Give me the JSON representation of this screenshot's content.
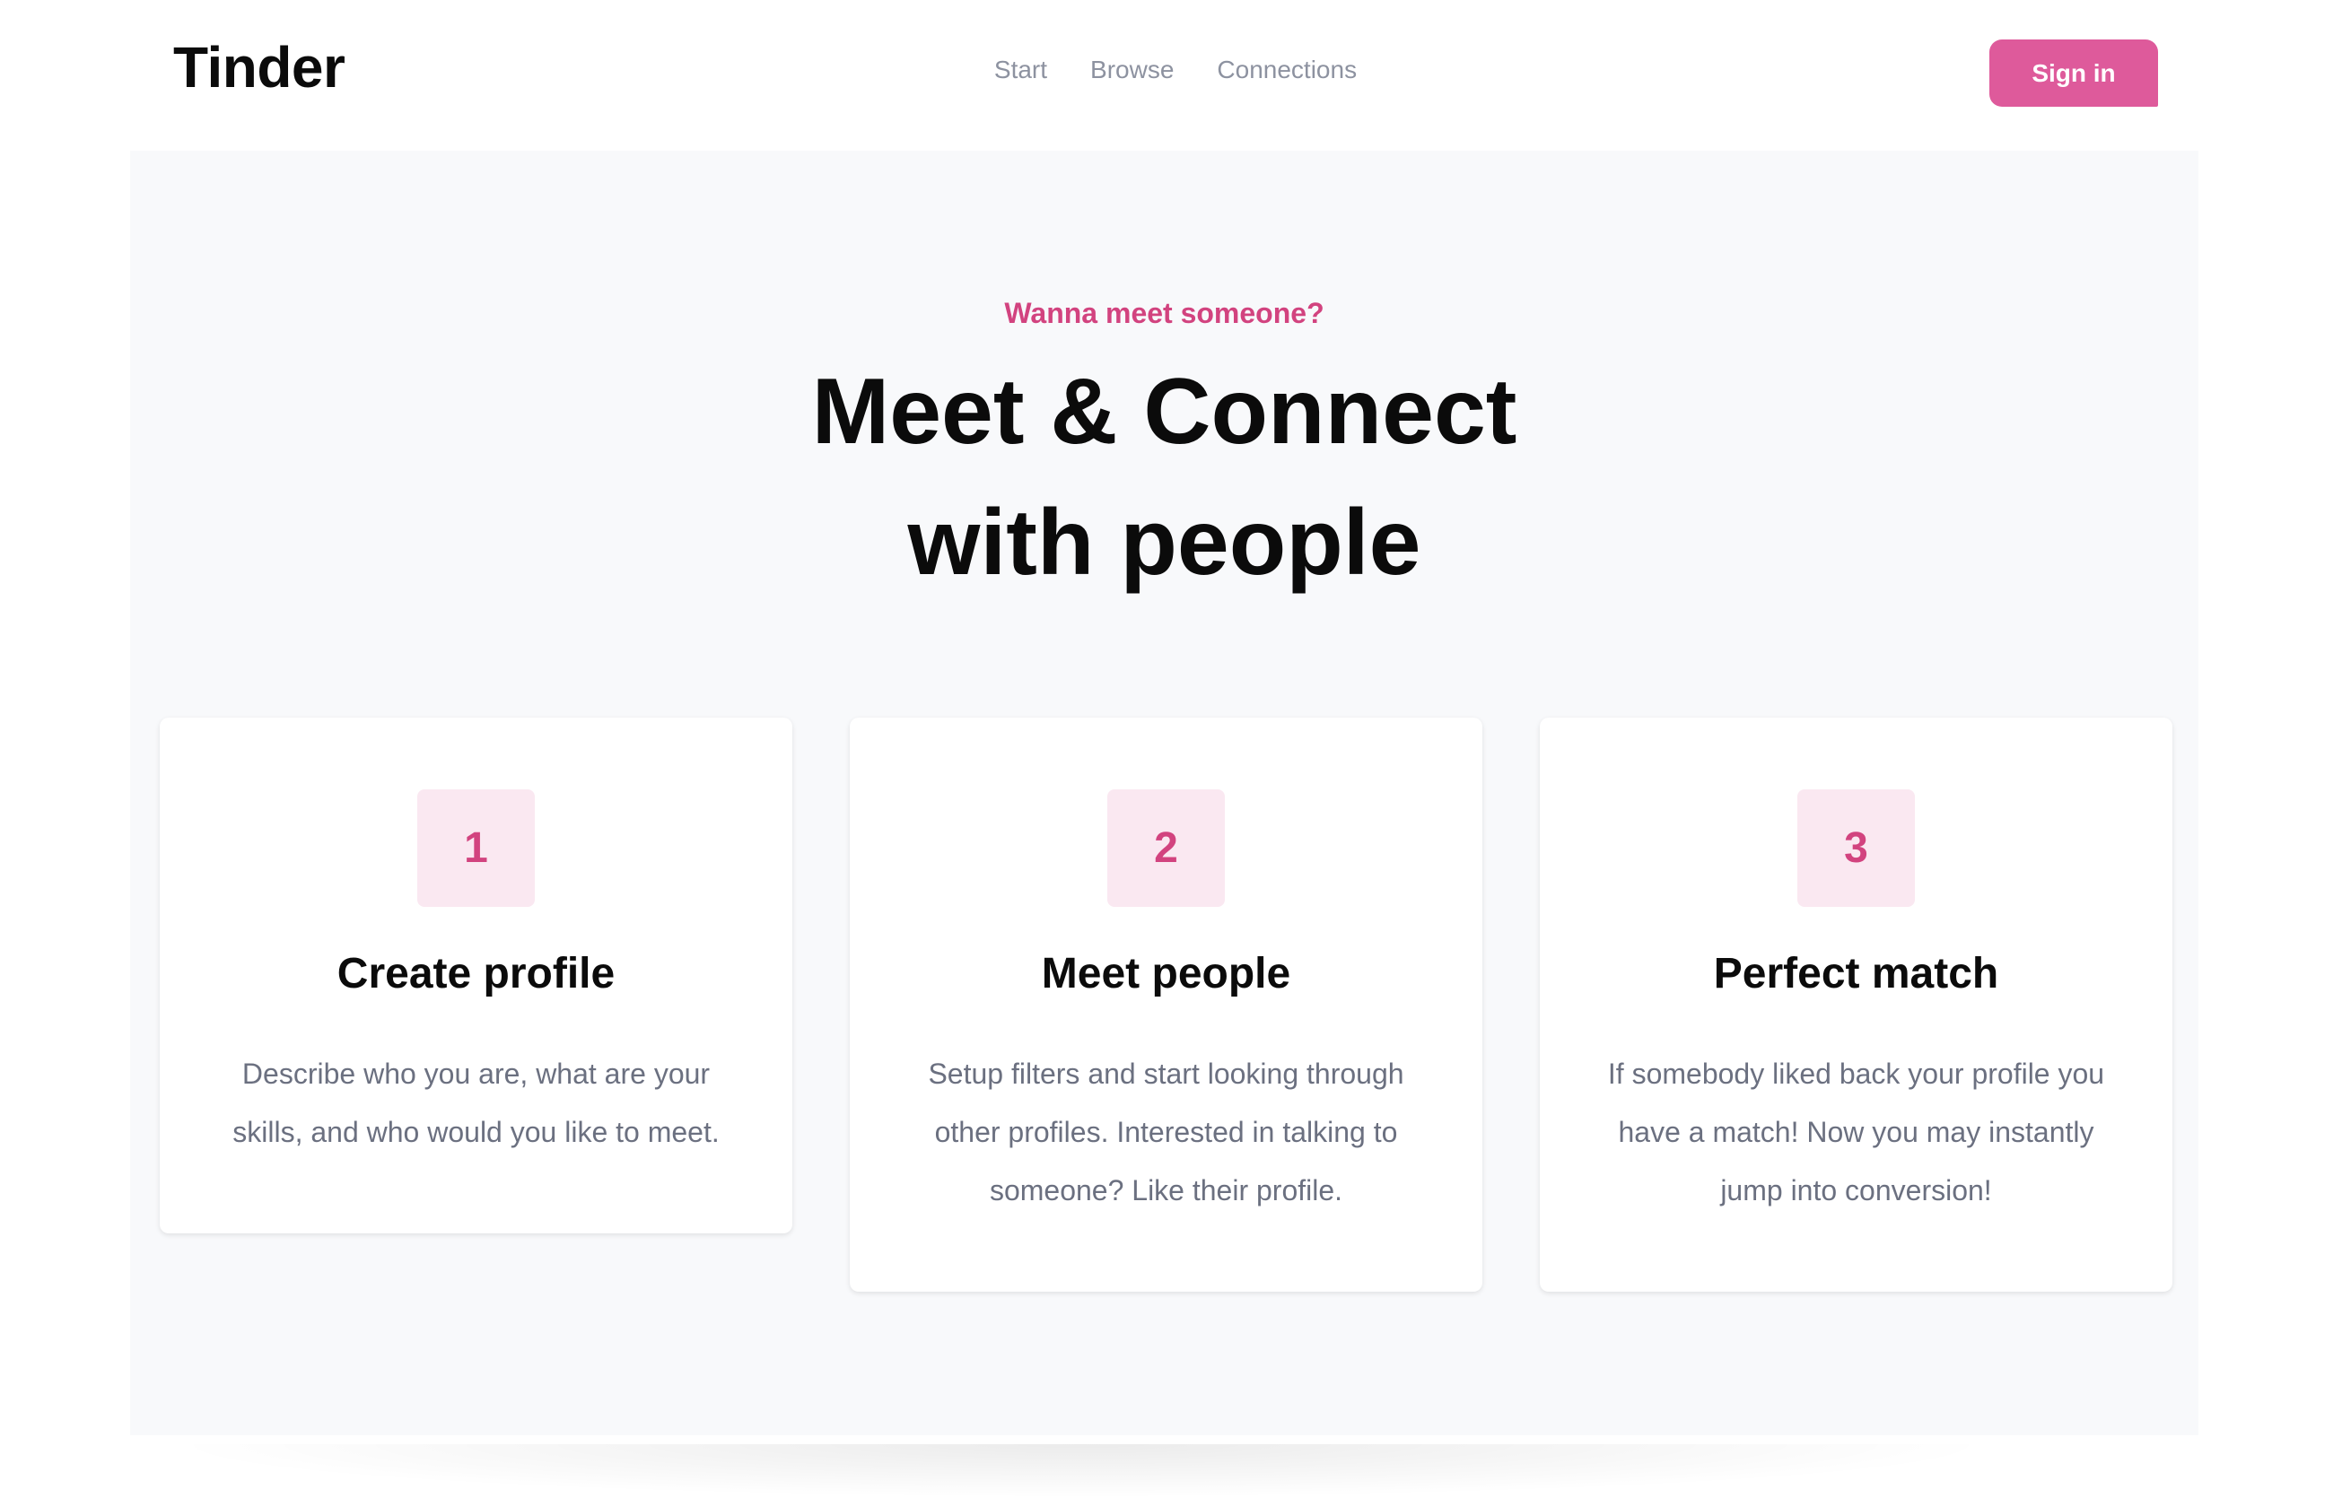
{
  "header": {
    "logo": "Tinder",
    "nav": [
      "Start",
      "Browse",
      "Connections"
    ],
    "signin_label": "Sign in"
  },
  "hero": {
    "eyebrow": "Wanna meet someone?",
    "headline_line1": "Meet & Connect",
    "headline_line2": "with people"
  },
  "steps": [
    {
      "number": "1",
      "title": "Create profile",
      "text": "Describe who you are, what are your skills, and who would you like to meet."
    },
    {
      "number": "2",
      "title": "Meet people",
      "text": "Setup filters and start looking through other profiles. Interested in talking to someone? Like their profile."
    },
    {
      "number": "3",
      "title": "Perfect match",
      "text": "If somebody liked back your profile you have a match! Now you may instantly jump into conversion!"
    }
  ],
  "colors": {
    "accent": "#de5a9b",
    "accent_text": "#d2437f",
    "accent_soft": "#fae8f1",
    "hero_bg": "#f8f9fb",
    "muted_text": "#6b7080",
    "nav_text": "#8d92a0"
  }
}
